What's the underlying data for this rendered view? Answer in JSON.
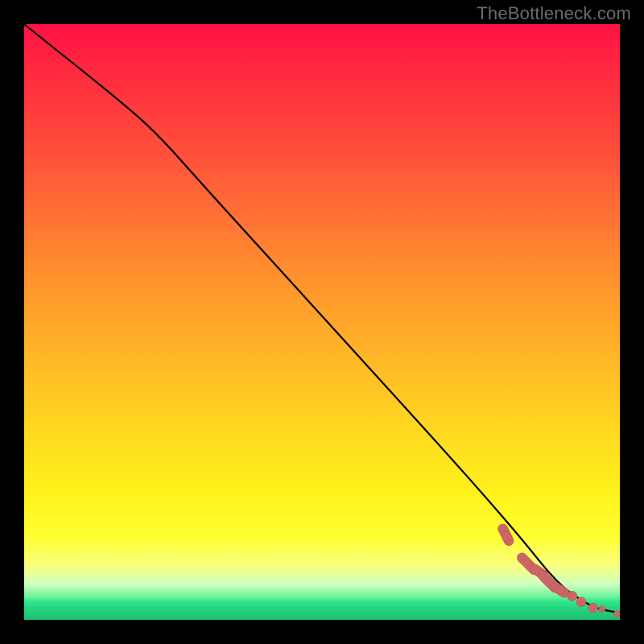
{
  "watermark": "TheBottleneck.com",
  "chart_data": {
    "type": "line",
    "title": "",
    "xlabel": "",
    "ylabel": "",
    "xlim": [
      0,
      100
    ],
    "ylim": [
      0,
      100
    ],
    "series": [
      {
        "name": "curve",
        "x": [
          0,
          5,
          15,
          22,
          30,
          40,
          50,
          60,
          70,
          78,
          84,
          88,
          91,
          94,
          96,
          98,
          100
        ],
        "values": [
          100,
          96,
          88,
          82,
          73,
          62,
          51,
          40,
          29,
          20,
          13,
          8,
          5,
          3,
          2,
          1.5,
          1.2
        ]
      }
    ],
    "data_points": {
      "name": "cluster",
      "comment": "Dense markers (salmon) near the bottom-right flat region of the curve",
      "x": [
        80,
        81,
        83,
        85,
        86.5,
        88.5,
        90,
        92,
        93.5,
        95.5,
        97,
        99.5
      ],
      "values": [
        16,
        14,
        11,
        9,
        8,
        6,
        5,
        4,
        3,
        2,
        1.8,
        1
      ]
    },
    "background_gradient": {
      "top": "#ff1144",
      "mid": "#ffd820",
      "low": "#ffff30",
      "bottom": "#1fbf72"
    }
  }
}
